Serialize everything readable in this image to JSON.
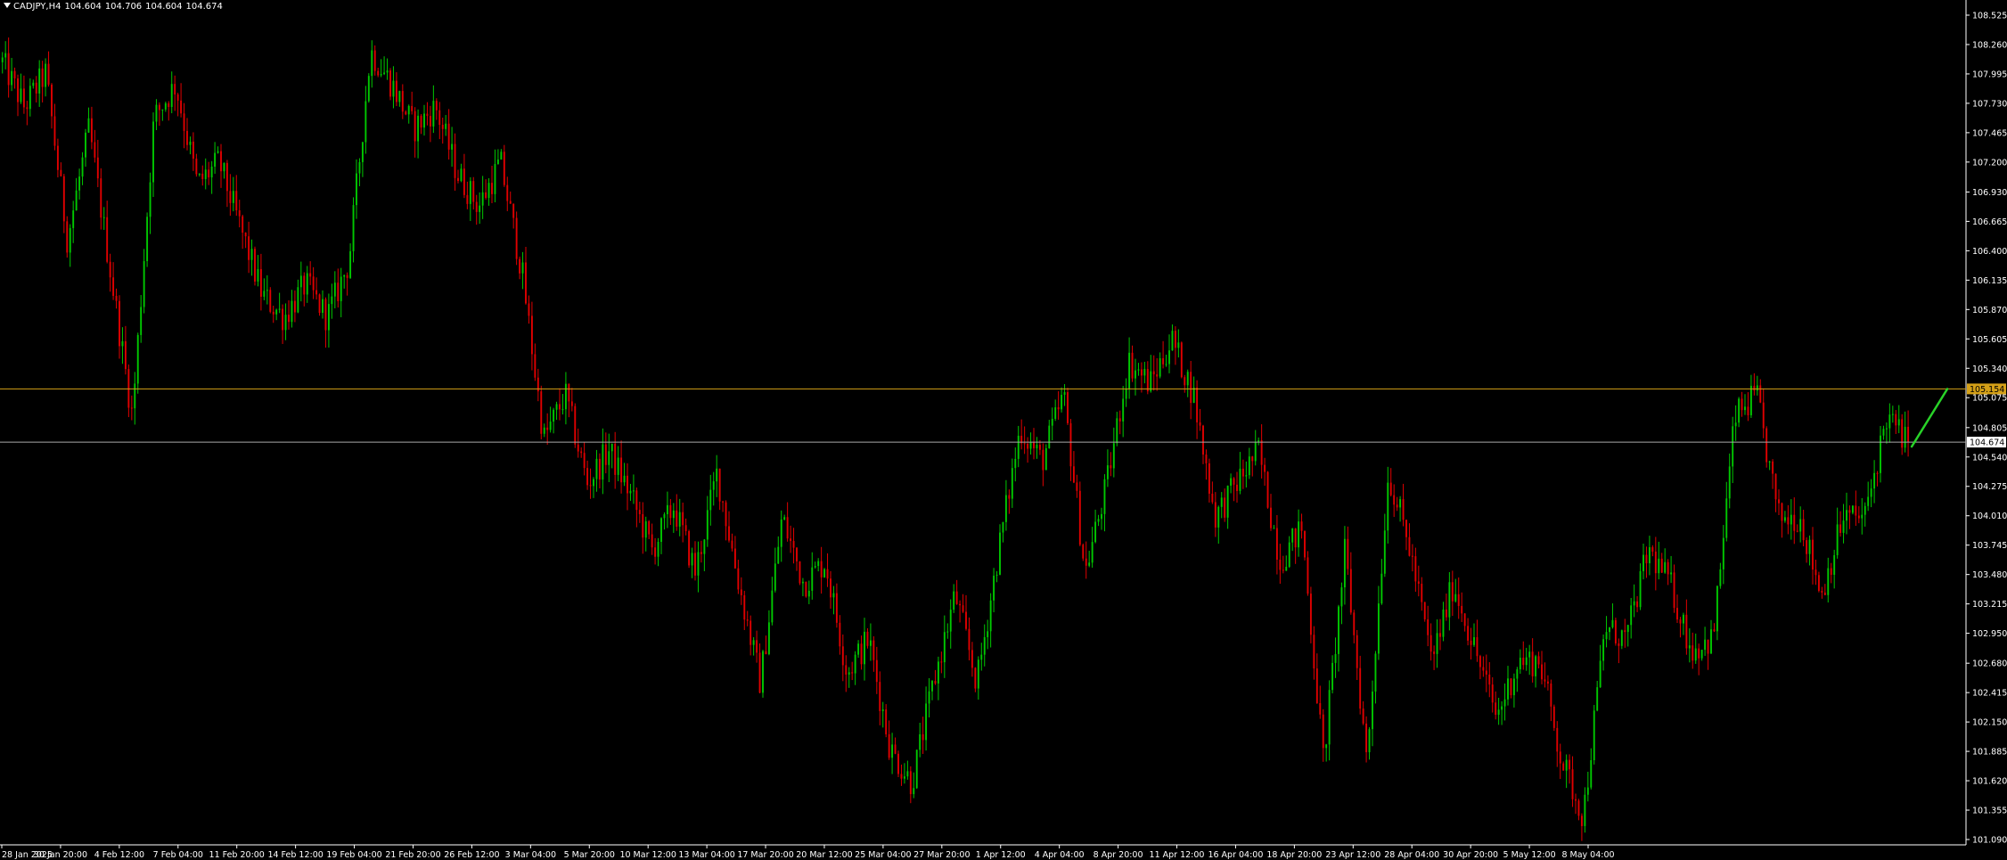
{
  "header": {
    "symbol": "CADJPY,H4",
    "open": "104.604",
    "high": "104.706",
    "low": "104.604",
    "close": "104.674"
  },
  "colors": {
    "background": "#000000",
    "bull": "#00c800",
    "bear": "#e00000",
    "axis_text": "#ffffff",
    "resistance": "#d4a017",
    "current_price_line": "#a8a8a8",
    "projection": "#28d228"
  },
  "chart_data": {
    "type": "candlestick",
    "timeframe": "H4",
    "y_axis": {
      "min": 101.09,
      "max": 108.525,
      "ticks": [
        "108.525",
        "108.260",
        "107.995",
        "107.730",
        "107.465",
        "107.200",
        "106.930",
        "106.665",
        "106.400",
        "106.135",
        "105.870",
        "105.605",
        "105.340",
        "105.075",
        "104.805",
        "104.540",
        "104.275",
        "104.010",
        "103.745",
        "103.480",
        "103.215",
        "102.950",
        "102.680",
        "102.415",
        "102.150",
        "101.885",
        "101.620",
        "101.355",
        "101.090"
      ]
    },
    "x_axis": {
      "labels": [
        "28 Jan 2025",
        "30 Jan 20:00",
        "4 Feb 12:00",
        "7 Feb 04:00",
        "11 Feb 20:00",
        "14 Feb 12:00",
        "19 Feb 04:00",
        "21 Feb 20:00",
        "26 Feb 12:00",
        "3 Mar 04:00",
        "5 Mar 20:00",
        "10 Mar 12:00",
        "13 Mar 04:00",
        "17 Mar 20:00",
        "20 Mar 12:00",
        "25 Mar 04:00",
        "27 Mar 20:00",
        "1 Apr 12:00",
        "4 Apr 04:00",
        "8 Apr 20:00",
        "11 Apr 12:00",
        "16 Apr 04:00",
        "18 Apr 20:00",
        "23 Apr 12:00",
        "28 Apr 04:00",
        "30 Apr 20:00",
        "5 May 12:00",
        "8 May 04:00"
      ]
    },
    "price_path": [
      108.1,
      107.7,
      108.0,
      106.5,
      107.5,
      106.2,
      104.9,
      107.6,
      107.9,
      107.0,
      107.2,
      106.6,
      106.0,
      105.8,
      106.1,
      105.8,
      106.3,
      108.2,
      107.9,
      107.5,
      107.7,
      107.1,
      106.8,
      107.2,
      106.2,
      104.7,
      105.1,
      104.3,
      104.6,
      104.2,
      103.7,
      104.1,
      103.5,
      104.4,
      103.4,
      102.5,
      104.0,
      103.4,
      103.6,
      102.6,
      102.9,
      101.9,
      101.6,
      102.5,
      103.3,
      102.5,
      103.7,
      104.8,
      104.5,
      105.1,
      103.5,
      104.3,
      105.4,
      105.2,
      105.6,
      105.1,
      104.0,
      104.3,
      104.6,
      103.6,
      103.9,
      101.8,
      103.7,
      101.8,
      104.4,
      103.7,
      102.7,
      103.4,
      102.8,
      102.2,
      102.7,
      102.7,
      101.8,
      101.3,
      103.0,
      102.9,
      103.7,
      103.4,
      102.8,
      102.9,
      104.9,
      105.1,
      104.0,
      104.0,
      103.3,
      104.0,
      104.0,
      104.9,
      104.67
    ],
    "resistance_level": 105.154,
    "resistance_label": "105.154",
    "current_price": 104.674,
    "current_price_label": "104.674",
    "projection": {
      "from_price": 104.674,
      "to_price": 105.154
    }
  }
}
